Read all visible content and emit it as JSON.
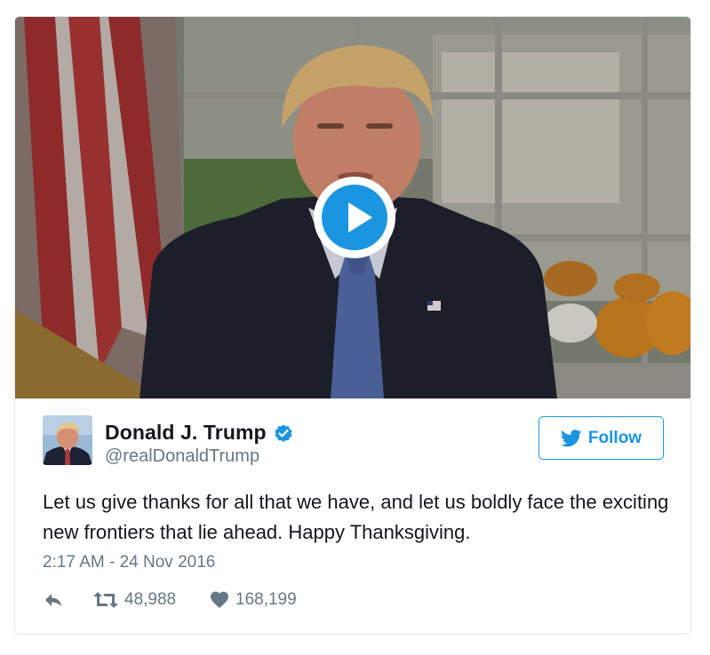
{
  "media": {
    "type": "video",
    "play_icon": "play-icon",
    "colors": {
      "play_button": "#1b95e0"
    }
  },
  "author": {
    "name": "Donald J. Trump",
    "handle": "@realDonaldTrump",
    "verified_icon": "verified-badge-icon"
  },
  "follow_button": {
    "label": "Follow",
    "icon": "twitter-bird-icon"
  },
  "tweet": {
    "text": "Let us give thanks for all that we have, and let us boldly face the exciting new frontiers that lie ahead. Happy Thanksgiving.",
    "timestamp": "2:17 AM - 24 Nov 2016"
  },
  "actions": {
    "reply_icon": "reply-icon",
    "retweet_icon": "retweet-icon",
    "retweet_count": "48,988",
    "like_icon": "heart-icon",
    "like_count": "168,199"
  },
  "colors": {
    "accent": "#1b95e0",
    "text": "#14171a",
    "secondary_text": "#657786",
    "border": "#e1e8ed"
  }
}
